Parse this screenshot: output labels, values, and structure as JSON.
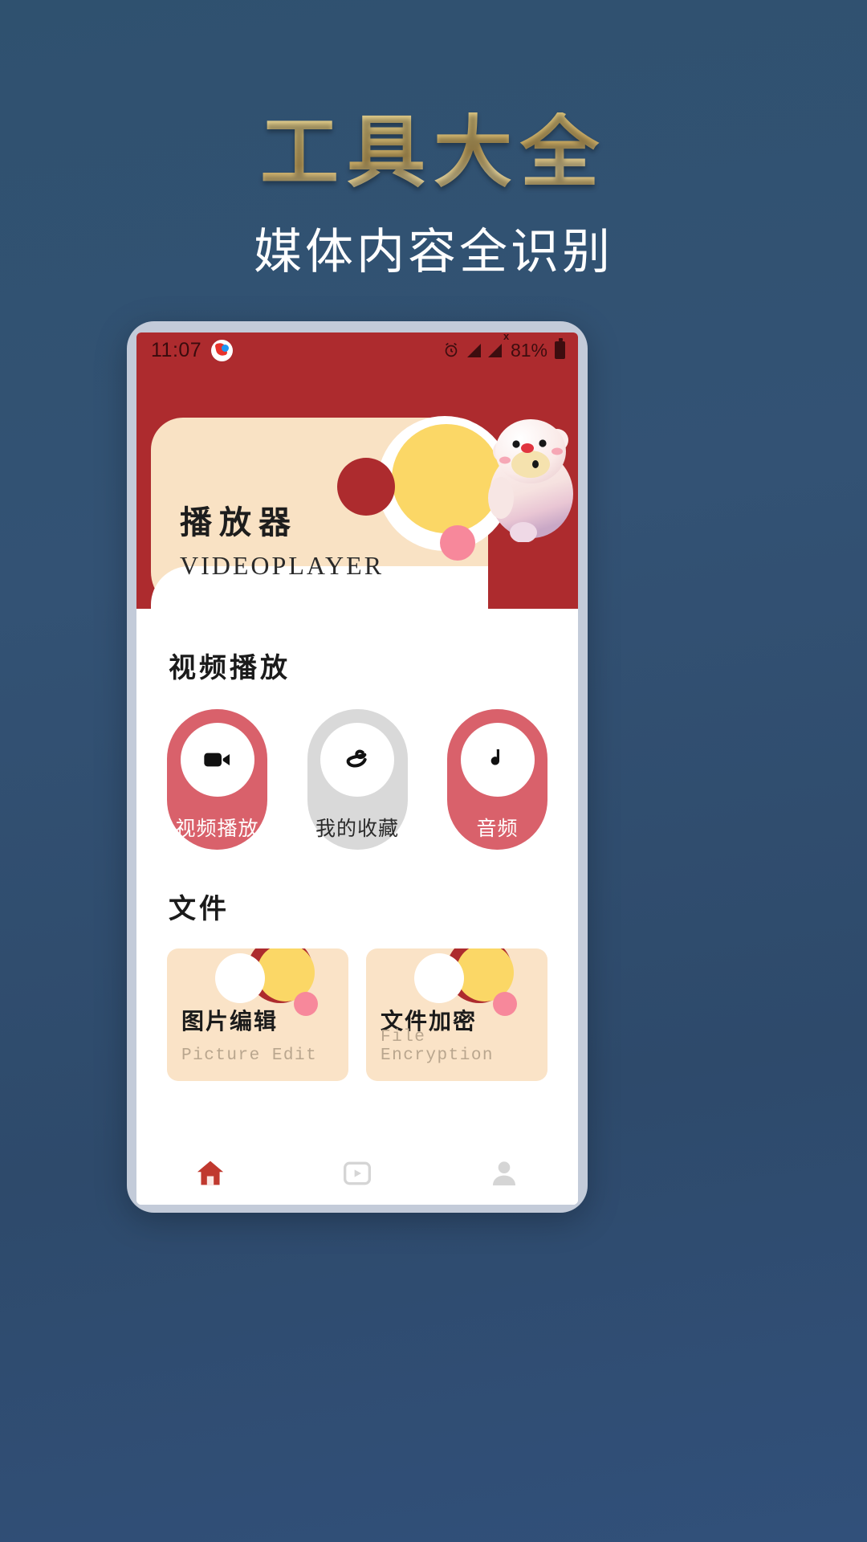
{
  "promo": {
    "title": "工具大全",
    "subtitle": "媒体内容全识别",
    "title_color": "#d2b46a",
    "subtitle_color": "#ffffff",
    "background_color": "#31506f"
  },
  "phone": {
    "frame_color": "#c3cbd9",
    "statusbar": {
      "time": "11:07",
      "notification_icon": "app-notification-icon",
      "alarm_icon": "alarm-clock-icon",
      "signal_icon": "signal-bars-icon",
      "signal_badge": "x",
      "battery_percent": "81%",
      "battery_icon": "battery-icon",
      "background_color": "#ad2b2e"
    },
    "hero": {
      "title_cn": "播放器",
      "title_en": "VIDEOPLAYER",
      "mascot": "bear-mascot",
      "card_color": "#f9e2c4",
      "background_color": "#ad2b2e",
      "accent_yellow": "#fbd766",
      "accent_pink": "#f7889b"
    },
    "sections": [
      {
        "id": "video-section",
        "title": "视频播放",
        "pills": [
          {
            "label": "视频播放",
            "icon": "video-camera-icon",
            "style": "red"
          },
          {
            "label": "我的收藏",
            "icon": "favorite-ribbon-icon",
            "style": "gray"
          },
          {
            "label": "音频",
            "icon": "music-note-icon",
            "style": "red"
          }
        ]
      },
      {
        "id": "file-section",
        "title": "文件",
        "cards": [
          {
            "title": "图片编辑",
            "subtitle": "Picture Edit"
          },
          {
            "title": "文件加密",
            "subtitle": "File Encryption"
          }
        ]
      }
    ],
    "navbar": {
      "items": [
        {
          "icon": "home-icon",
          "active": true,
          "color": "#c0392f"
        },
        {
          "icon": "play-icon",
          "active": false,
          "color": "#d5d5d5"
        },
        {
          "icon": "profile-icon",
          "active": false,
          "color": "#d5d5d5"
        }
      ]
    }
  }
}
